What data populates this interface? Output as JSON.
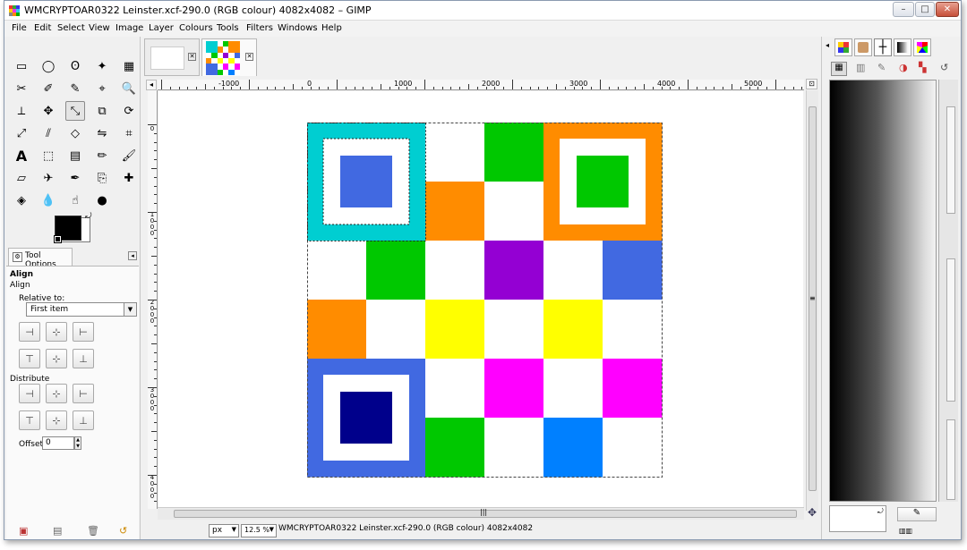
{
  "window": {
    "title": "WMCRYPTOAR0322 Leinster.xcf-290.0 (RGB colour) 4082x4082 – GIMP",
    "minimize": "–",
    "maximize": "□",
    "close": "✕"
  },
  "menu": [
    "File",
    "Edit",
    "Select",
    "View",
    "Image",
    "Layer",
    "Colours",
    "Tools",
    "Filters",
    "Windows",
    "Help"
  ],
  "tool_options": {
    "tab_label": "Tool Options",
    "title": "Align",
    "subtitle": "Align",
    "relative_label": "Relative to:",
    "relative_value": "First item",
    "distribute_label": "Distribute",
    "offset_label": "Offset:",
    "offset_value": "0"
  },
  "ruler": {
    "h_labels": [
      "-1000",
      "0",
      "1000",
      "2000",
      "3000",
      "4000",
      "5000"
    ],
    "v_labels": [
      "0",
      "1000",
      "2000",
      "3000",
      "4000"
    ]
  },
  "status": {
    "unit": "px",
    "zoom": "12.5 %",
    "text": "WMCRYPTOAR0322 Leinster.xcf-290.0 (RGB colour) 4082x4082"
  },
  "colors": {
    "cyan": "#00ced1",
    "royal_blue": "#4169e1",
    "orange": "#ff8c00",
    "green": "#00c800",
    "purple": "#9400d3",
    "yellow": "#ffff00",
    "magenta": "#ff00ff",
    "dodger_blue": "#0080ff",
    "navy": "#00008b",
    "white": "#ffffff"
  },
  "image_grid": [
    [
      "cyan",
      "cyan",
      "white",
      "green",
      "orange",
      "orange"
    ],
    [
      "cyan",
      "cyan",
      "orange",
      "white",
      "orange",
      "orange"
    ],
    [
      "white",
      "green",
      "white",
      "purple",
      "white",
      "royal_blue"
    ],
    [
      "orange",
      "white",
      "yellow",
      "white",
      "yellow",
      "white"
    ],
    [
      "royal_blue",
      "royal_blue",
      "white",
      "magenta",
      "white",
      "magenta"
    ],
    [
      "royal_blue",
      "royal_blue",
      "green",
      "white",
      "dodger_blue",
      "white"
    ]
  ],
  "image_insets": [
    {
      "row": 0,
      "col": 0,
      "frame": "white",
      "core": "royal_blue"
    },
    {
      "row": 0,
      "col": 4,
      "frame": "white",
      "core": "green"
    },
    {
      "row": 4,
      "col": 0,
      "frame": "white",
      "core": "navy"
    }
  ],
  "icons": {
    "tools": [
      "rect-select-icon",
      "ellipse-select-icon",
      "lasso-icon",
      "fuzzy-select-icon",
      "select-by-color-icon",
      "scissors-icon",
      "foreground-select-icon",
      "paths-icon",
      "color-picker-icon",
      "zoom-icon",
      "measure-icon",
      "move-icon",
      "align-icon",
      "crop-icon",
      "rotate-icon",
      "scale-icon",
      "shear-icon",
      "perspective-icon",
      "flip-icon",
      "cage-icon",
      "text-icon",
      "bucket-fill-icon",
      "blend-icon",
      "pencil-icon",
      "paintbrush-icon",
      "eraser-icon",
      "airbrush-icon",
      "ink-icon",
      "clone-icon",
      "heal-icon",
      "perspective-clone-icon",
      "blur-icon",
      "smudge-icon",
      "dodge-burn-icon"
    ]
  }
}
